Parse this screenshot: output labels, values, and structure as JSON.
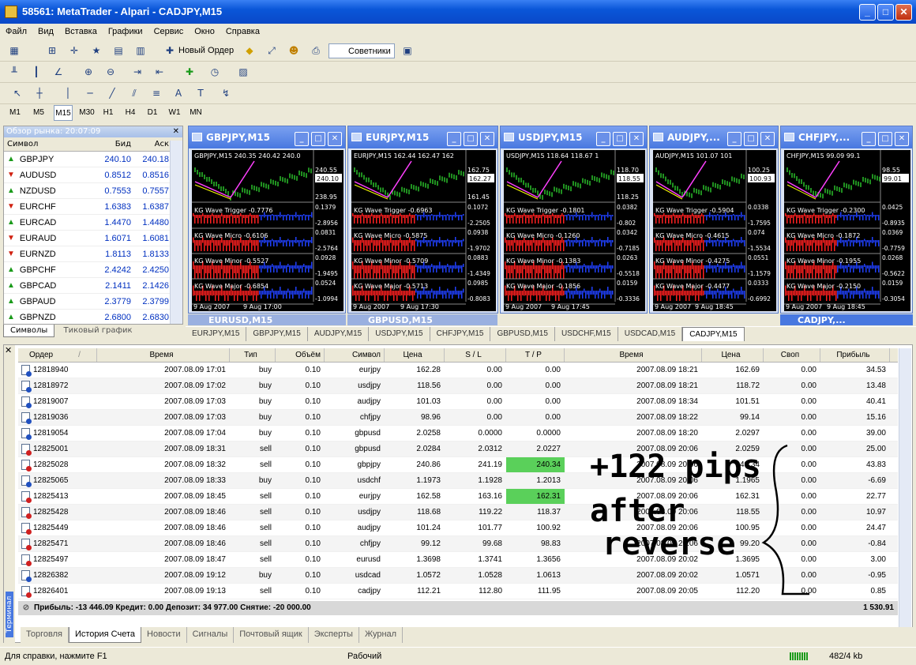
{
  "app": {
    "title": "58561: MetaTrader - Alpari - CADJPY,M15"
  },
  "menu": [
    "Файл",
    "Вид",
    "Вставка",
    "Графики",
    "Сервис",
    "Окно",
    "Справка"
  ],
  "toolbar": {
    "new_order": "Новый Ордер",
    "experts": "Советники"
  },
  "timeframes": [
    "M1",
    "M5",
    "M15",
    "M30",
    "H1",
    "H4",
    "D1",
    "W1",
    "MN"
  ],
  "market_watch": {
    "title": "Обзор рынка: 20:07:09",
    "headers": [
      "Символ",
      "Бид",
      "Аск"
    ],
    "rows": [
      {
        "sym": "GBPJPY",
        "bid": "240.10",
        "ask": "240.18",
        "dir": "up"
      },
      {
        "sym": "AUDUSD",
        "bid": "0.8512",
        "ask": "0.8516",
        "dir": "down"
      },
      {
        "sym": "NZDUSD",
        "bid": "0.7553",
        "ask": "0.7557",
        "dir": "up"
      },
      {
        "sym": "EURCHF",
        "bid": "1.6383",
        "ask": "1.6387",
        "dir": "down"
      },
      {
        "sym": "EURCAD",
        "bid": "1.4470",
        "ask": "1.4480",
        "dir": "up"
      },
      {
        "sym": "EURAUD",
        "bid": "1.6071",
        "ask": "1.6081",
        "dir": "down"
      },
      {
        "sym": "EURNZD",
        "bid": "1.8113",
        "ask": "1.8133",
        "dir": "down"
      },
      {
        "sym": "GBPCHF",
        "bid": "2.4242",
        "ask": "2.4250",
        "dir": "up"
      },
      {
        "sym": "GBPCAD",
        "bid": "2.1411",
        "ask": "2.1426",
        "dir": "up"
      },
      {
        "sym": "GBPAUD",
        "bid": "2.3779",
        "ask": "2.3799",
        "dir": "up"
      },
      {
        "sym": "GBPNZD",
        "bid": "2.6800",
        "ask": "2.6830",
        "dir": "up"
      }
    ],
    "tabs": [
      "Символы",
      "Тиковый график"
    ]
  },
  "charts": [
    {
      "title": "GBPJPY,M15",
      "label": "GBPJPY,M15  240.35 240.42 240.0",
      "price": "240.10",
      "ticks": [
        "240.55",
        "238.95"
      ],
      "ind": [
        "KG Wave Trigger -0.7776",
        "KG Wave Micro -0.6106",
        "KG Wave Minor -0.5527",
        "KG Wave Major -0.6854"
      ],
      "iv": [
        "0.1379",
        "-2.8956",
        "0.0831",
        "-2.5764",
        "0.0928",
        "-1.9495",
        "0.0524",
        "-1.0994"
      ],
      "dates": [
        "9 Aug 2007",
        "9 Aug 17:00"
      ]
    },
    {
      "title": "EURJPY,M15",
      "label": "EURJPY,M15  162.44 162.47 162",
      "price": "162.27",
      "ticks": [
        "162.75",
        "161.45"
      ],
      "ind": [
        "KG Wave Trigger -0.6963",
        "KG Wave Micro -0.5875",
        "KG Wave Minor -0.5709",
        "KG Wave Major -0.5713"
      ],
      "iv": [
        "0.1072",
        "-2.2505",
        "0.0938",
        "-1.9702",
        "0.0883",
        "-1.4349",
        "0.0985",
        "-0.8083"
      ],
      "dates": [
        "9 Aug 2007",
        "9 Aug 17:30"
      ]
    },
    {
      "title": "USDJPY,M15",
      "label": "USDJPY,M15  118.64 118.67 1",
      "price": "118.55",
      "ticks": [
        "118.70",
        "118.25"
      ],
      "ind": [
        "KG Wave Trigger -0.1801",
        "KG Wave Micro -0.1260",
        "KG Wave Minor -0.1383",
        "KG Wave Major -0.1856"
      ],
      "iv": [
        "0.0382",
        "-0.802",
        "0.0342",
        "-0.7185",
        "0.0263",
        "-0.5518",
        "0.0159",
        "-0.3336"
      ],
      "dates": [
        "9 Aug 2007",
        "9 Aug 17:45"
      ]
    },
    {
      "title": "AUDJPY,...",
      "label": "AUDJPY,M15  101.07 101",
      "price": "100.93",
      "ticks": [
        "100.25"
      ],
      "ind": [
        "KG Wave Trigger -0.5904",
        "KG Wave Micro -0.4615",
        "KG Wave Minor -0.4275",
        "KG Wave Major -0.4477"
      ],
      "iv": [
        "0.0338",
        "-1.7595",
        "0.074",
        "-1.5534",
        "0.0551",
        "-1.1579",
        "0.0333",
        "-0.6992"
      ],
      "dates": [
        "9 Aug 2007",
        "9 Aug 18:45"
      ]
    },
    {
      "title": "CHFJPY,...",
      "label": "CHFJPY,M15  99.09 99.1",
      "price": "99.01",
      "ticks": [
        "98.55"
      ],
      "ind": [
        "KG Wave Trigger -0.2300",
        "KG Wave Micro -0.1872",
        "KG Wave Minor -0.1955",
        "KG Wave Major -0.2150"
      ],
      "iv": [
        "0.0425",
        "-0.8935",
        "0.0369",
        "-0.7759",
        "0.0268",
        "-0.5622",
        "0.0159",
        "-0.3054"
      ],
      "dates": [
        "9 Aug 2007",
        "9 Aug 18:45"
      ]
    }
  ],
  "hidden_windows": [
    "EURUSD,M15",
    "GBPUSD,M15",
    "CADJPY,..."
  ],
  "chart_tabs": [
    "EURJPY,M15",
    "GBPJPY,M15",
    "AUDJPY,M15",
    "USDJPY,M15",
    "CHFJPY,M15",
    "GBPUSD,M15",
    "USDCHF,M15",
    "USDCAD,M15",
    "CADJPY,M15"
  ],
  "terminal": {
    "side_label": "Терминал",
    "headers": [
      "Ордер",
      "/",
      "Время",
      "Тип",
      "Объём",
      "Символ",
      "Цена",
      "S / L",
      "T / P",
      "Время",
      "Цена",
      "Своп",
      "Прибыль"
    ],
    "rows": [
      [
        "12818940",
        "2007.08.09 17:01",
        "buy",
        "0.10",
        "eurjpy",
        "162.28",
        "0.00",
        "0.00",
        "2007.08.09 18:21",
        "162.69",
        "0.00",
        "34.53"
      ],
      [
        "12818972",
        "2007.08.09 17:02",
        "buy",
        "0.10",
        "usdjpy",
        "118.56",
        "0.00",
        "0.00",
        "2007.08.09 18:21",
        "118.72",
        "0.00",
        "13.48"
      ],
      [
        "12819007",
        "2007.08.09 17:03",
        "buy",
        "0.10",
        "audjpy",
        "101.03",
        "0.00",
        "0.00",
        "2007.08.09 18:34",
        "101.51",
        "0.00",
        "40.41"
      ],
      [
        "12819036",
        "2007.08.09 17:03",
        "buy",
        "0.10",
        "chfjpy",
        "98.96",
        "0.00",
        "0.00",
        "2007.08.09 18:22",
        "99.14",
        "0.00",
        "15.16"
      ],
      [
        "12819054",
        "2007.08.09 17:04",
        "buy",
        "0.10",
        "gbpusd",
        "2.0258",
        "0.0000",
        "0.0000",
        "2007.08.09 18:20",
        "2.0297",
        "0.00",
        "39.00"
      ],
      [
        "12825001",
        "2007.08.09 18:31",
        "sell",
        "0.10",
        "gbpusd",
        "2.0284",
        "2.0312",
        "2.0227",
        "2007.08.09 20:06",
        "2.0259",
        "0.00",
        "25.00"
      ],
      [
        "12825028",
        "2007.08.09 18:32",
        "sell",
        "0.10",
        "gbpjpy",
        "240.86",
        "241.19",
        "240.34",
        "2007.08.09 20:06",
        "240.34",
        "0.00",
        "43.83"
      ],
      [
        "12825065",
        "2007.08.09 18:33",
        "buy",
        "0.10",
        "usdchf",
        "1.1973",
        "1.1928",
        "1.2013",
        "2007.08.09 20:06",
        "1.1965",
        "0.00",
        "-6.69"
      ],
      [
        "12825413",
        "2007.08.09 18:45",
        "sell",
        "0.10",
        "eurjpy",
        "162.58",
        "163.16",
        "162.31",
        "2007.08.09 20:06",
        "162.31",
        "0.00",
        "22.77"
      ],
      [
        "12825428",
        "2007.08.09 18:46",
        "sell",
        "0.10",
        "usdjpy",
        "118.68",
        "119.22",
        "118.37",
        "2007.08.09 20:06",
        "118.55",
        "0.00",
        "10.97"
      ],
      [
        "12825449",
        "2007.08.09 18:46",
        "sell",
        "0.10",
        "audjpy",
        "101.24",
        "101.77",
        "100.92",
        "2007.08.09 20:06",
        "100.95",
        "0.00",
        "24.47"
      ],
      [
        "12825471",
        "2007.08.09 18:46",
        "sell",
        "0.10",
        "chfjpy",
        "99.12",
        "99.68",
        "98.83",
        "2007.08.09 20:06",
        "99.20",
        "0.00",
        "-0.84"
      ],
      [
        "12825497",
        "2007.08.09 18:47",
        "sell",
        "0.10",
        "eurusd",
        "1.3698",
        "1.3741",
        "1.3656",
        "2007.08.09 20:02",
        "1.3695",
        "0.00",
        "3.00"
      ],
      [
        "12826382",
        "2007.08.09 19:12",
        "buy",
        "0.10",
        "usdcad",
        "1.0572",
        "1.0528",
        "1.0613",
        "2007.08.09 20:02",
        "1.0571",
        "0.00",
        "-0.95"
      ],
      [
        "12826401",
        "2007.08.09 19:13",
        "sell",
        "0.10",
        "cadjpy",
        "112.21",
        "112.80",
        "111.95",
        "2007.08.09 20:05",
        "112.20",
        "0.00",
        "0.85"
      ]
    ],
    "summary": "Прибыль: -13 446.09  Кредит: 0.00  Депозит: 34 977.00  Снятие: -20 000.00",
    "summary_total": "1 530.91",
    "tabs": [
      "Торговля",
      "История Счета",
      "Новости",
      "Сигналы",
      "Почтовый ящик",
      "Эксперты",
      "Журнал"
    ],
    "annotation": [
      "+122 pips",
      "after",
      "reverse"
    ]
  },
  "status": {
    "help": "Для справки, нажмите F1",
    "mode": "Рабочий",
    "traffic": "482/4 kb"
  }
}
